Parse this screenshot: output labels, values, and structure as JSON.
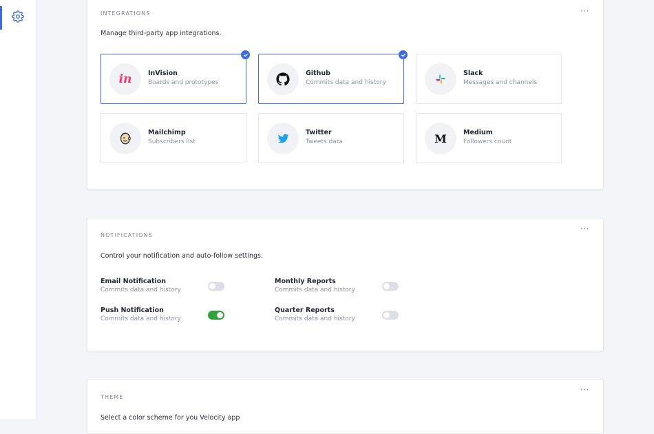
{
  "sidebar": {
    "items": [
      {
        "icon": "gear-icon",
        "active": true
      }
    ]
  },
  "integrations": {
    "title": "INTEGRATIONS",
    "menu": "···",
    "description": "Manage third-party app integrations.",
    "apps": [
      {
        "name": "InVision",
        "sub": "Boards and prototypes",
        "icon": "invision-icon",
        "selected": true,
        "logo_text": "in"
      },
      {
        "name": "Github",
        "sub": "Commits data and history",
        "icon": "github-icon",
        "selected": true
      },
      {
        "name": "Slack",
        "sub": "Messages and channels",
        "icon": "slack-icon",
        "selected": false
      },
      {
        "name": "Mailchimp",
        "sub": "Subscribers list",
        "icon": "mailchimp-icon",
        "selected": false
      },
      {
        "name": "Twitter",
        "sub": "Tweets data",
        "icon": "twitter-icon",
        "selected": false
      },
      {
        "name": "Medium",
        "sub": "Followers count",
        "icon": "medium-icon",
        "selected": false,
        "logo_text": "M"
      }
    ]
  },
  "notifications": {
    "title": "NOTIFICATIONS",
    "menu": "···",
    "description": "Control your notification and auto-follow settings.",
    "items": [
      {
        "name": "Email Notification",
        "sub": "Commits data and history",
        "enabled": false
      },
      {
        "name": "Monthly Reports",
        "sub": "Commits data and history",
        "enabled": false
      },
      {
        "name": "Push Notification",
        "sub": "Commits data and history",
        "enabled": true
      },
      {
        "name": "Quarter Reports",
        "sub": "Commits data and history",
        "enabled": false
      }
    ]
  },
  "theme": {
    "title": "THEME",
    "menu": "···",
    "description": "Select a color scheme for you Velocity app"
  },
  "colors": {
    "accent": "#3d6be6",
    "toggle_on": "#2fa43b",
    "toggle_off": "#dcdfe5",
    "invision": "#ff3366",
    "twitter": "#1da1f2"
  }
}
